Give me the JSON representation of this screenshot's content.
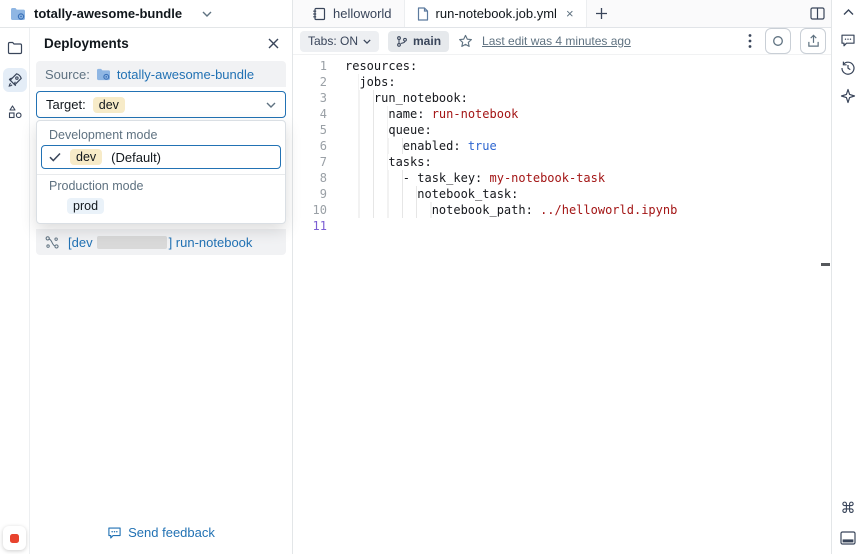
{
  "colors": {
    "accent": "#2272B4",
    "tan_badge_bg": "#F7EBC8",
    "blue_badge_bg": "#EAF2F9",
    "row_bg": "#F1F2F4",
    "code_string": "#A31515",
    "code_bool": "#2E66D0",
    "active_line_number": "#7C5FD3"
  },
  "header": {
    "bundle_name": "totally-awesome-bundle"
  },
  "left_rail": {
    "items": [
      "workspace-folder",
      "deployments",
      "resources"
    ]
  },
  "panel": {
    "title": "Deployments",
    "source": {
      "label": "Source:",
      "value": "totally-awesome-bundle"
    },
    "target": {
      "label": "Target:",
      "value": "dev"
    },
    "dropdown": {
      "groups": [
        {
          "label": "Development mode",
          "options": [
            {
              "name": "dev",
              "suffix": "(Default)",
              "selected": true
            }
          ]
        },
        {
          "label": "Production mode",
          "options": [
            {
              "name": "prod",
              "suffix": "",
              "selected": false
            }
          ]
        }
      ]
    },
    "job_link": {
      "prefix": "[dev",
      "redacted": true,
      "suffix": "] run-notebook"
    },
    "feedback": "Send feedback"
  },
  "editor": {
    "tabs": [
      {
        "label": "helloworld",
        "icon": "notebook-icon",
        "active": false
      },
      {
        "label": "run-notebook.job.yml",
        "icon": "file-icon",
        "active": true,
        "close": "×"
      }
    ],
    "new_tab_label": "+",
    "toolbar": {
      "tabs_toggle": "Tabs: ON",
      "branch": "main",
      "last_edit": "Last edit was 4 minutes ago"
    },
    "code": {
      "language": "yaml",
      "active_line": 11,
      "lines": [
        {
          "n": 1,
          "indent": 0,
          "tokens": [
            {
              "t": "resources:",
              "c": "k"
            }
          ]
        },
        {
          "n": 2,
          "indent": 2,
          "tokens": [
            {
              "t": "jobs:",
              "c": "k"
            }
          ]
        },
        {
          "n": 3,
          "indent": 4,
          "tokens": [
            {
              "t": "run_notebook:",
              "c": "k"
            }
          ]
        },
        {
          "n": 4,
          "indent": 6,
          "tokens": [
            {
              "t": "name: ",
              "c": "k"
            },
            {
              "t": "run-notebook",
              "c": "s"
            }
          ]
        },
        {
          "n": 5,
          "indent": 6,
          "tokens": [
            {
              "t": "queue:",
              "c": "k"
            }
          ]
        },
        {
          "n": 6,
          "indent": 8,
          "tokens": [
            {
              "t": "enabled: ",
              "c": "k"
            },
            {
              "t": "true",
              "c": "b"
            }
          ]
        },
        {
          "n": 7,
          "indent": 6,
          "tokens": [
            {
              "t": "tasks:",
              "c": "k"
            }
          ]
        },
        {
          "n": 8,
          "indent": 8,
          "tokens": [
            {
              "t": "- task_key: ",
              "c": "k"
            },
            {
              "t": "my-notebook-task",
              "c": "s"
            }
          ]
        },
        {
          "n": 9,
          "indent": 10,
          "tokens": [
            {
              "t": "notebook_task:",
              "c": "k"
            }
          ]
        },
        {
          "n": 10,
          "indent": 12,
          "tokens": [
            {
              "t": "notebook_path: ",
              "c": "k"
            },
            {
              "t": "../helloworld.ipynb",
              "c": "s"
            }
          ]
        },
        {
          "n": 11,
          "indent": 0,
          "active": true,
          "tokens": []
        }
      ]
    }
  },
  "right_rail": {
    "top_icons": [
      "collapse",
      "comments",
      "history",
      "assistant"
    ],
    "bottom_icons": [
      "shortcuts",
      "bottom-panel"
    ],
    "command_glyph": "⌘"
  }
}
